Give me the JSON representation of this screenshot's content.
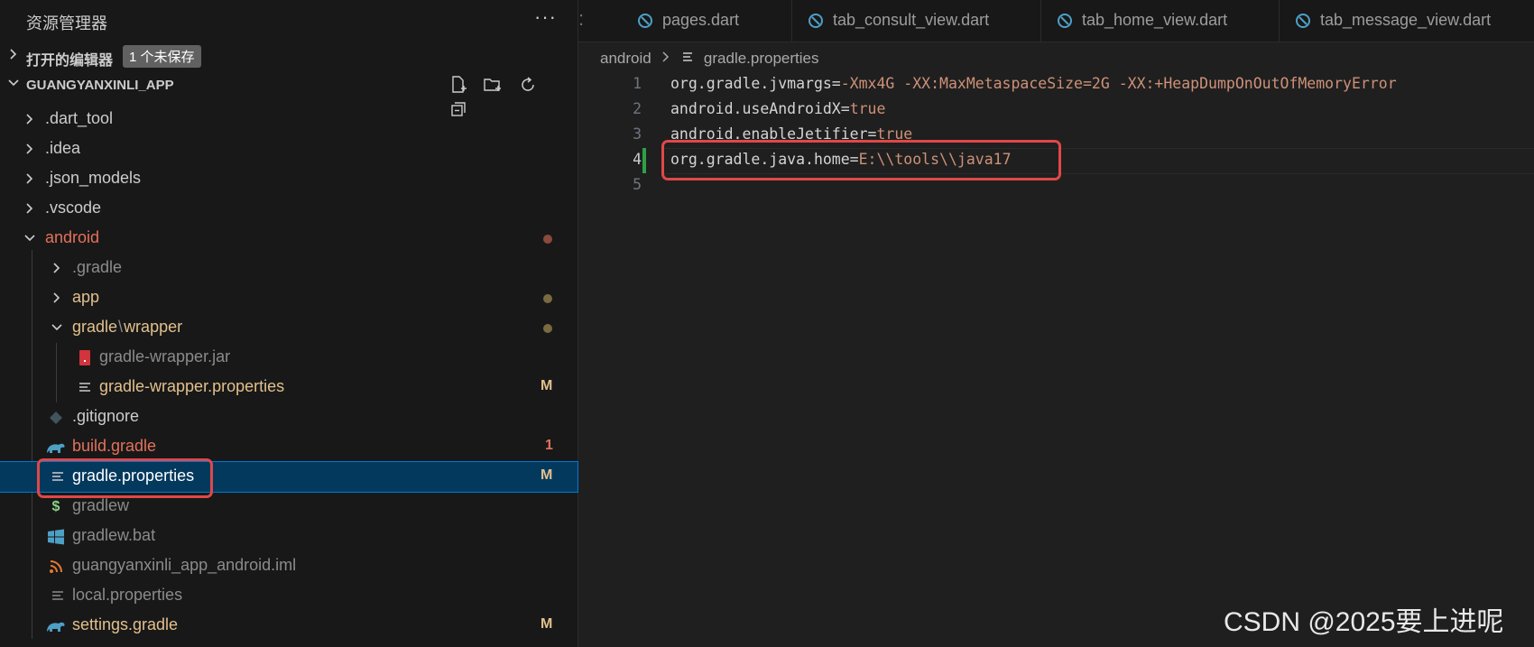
{
  "explorer": {
    "title": "资源管理器",
    "more": "···",
    "open_editors": {
      "label": "打开的编辑器",
      "badge": "1 个未保存"
    },
    "project": {
      "label": "GUANGYANXINLI_APP"
    },
    "tree": [
      {
        "name": ".dart_tool",
        "type": "folder",
        "icon": "chevron-right",
        "color": "#cccccc"
      },
      {
        "name": ".idea",
        "type": "folder",
        "icon": "chevron-right",
        "color": "#cccccc"
      },
      {
        "name": ".json_models",
        "type": "folder",
        "icon": "chevron-right",
        "color": "#cccccc"
      },
      {
        "name": ".vscode",
        "type": "folder",
        "icon": "chevron-right",
        "color": "#cccccc"
      },
      {
        "name": "android",
        "type": "folder-open",
        "icon": "chevron-down",
        "color": "#e2725b",
        "status_dot": "#8b4a3c"
      },
      {
        "name": ".gradle",
        "type": "folder",
        "icon": "chevron-right",
        "color": "#8b8b8b"
      },
      {
        "name": "app",
        "type": "folder",
        "icon": "chevron-right",
        "color": "#e2c08d",
        "status_dot": "#7a6a40"
      },
      {
        "name_a": "gradle",
        "sep": "\\",
        "name_b": "wrapper",
        "type": "folder-open",
        "icon": "chevron-down",
        "color": "#e2c08d",
        "status_dot": "#7a6a40"
      },
      {
        "name": "gradle-wrapper.jar",
        "type": "file",
        "icon": "jar-icon",
        "color": "#8b8b8b"
      },
      {
        "name": "gradle-wrapper.properties",
        "type": "file",
        "icon": "properties-icon",
        "color": "#e2c08d",
        "status": "M"
      },
      {
        "name": ".gitignore",
        "type": "file",
        "icon": "git-icon",
        "color": "#cccccc"
      },
      {
        "name": "build.gradle",
        "type": "file",
        "icon": "gradle-icon",
        "color": "#e2725b",
        "status": "1"
      },
      {
        "name": "gradle.properties",
        "type": "file",
        "icon": "properties-icon",
        "color": "#ffffff",
        "status": "M"
      },
      {
        "name": "gradlew",
        "type": "file",
        "icon": "shell-icon",
        "color": "#8b8b8b"
      },
      {
        "name": "gradlew.bat",
        "type": "file",
        "icon": "windows-icon",
        "color": "#8b8b8b"
      },
      {
        "name": "guangyanxinli_app_android.iml",
        "type": "file",
        "icon": "rss-icon",
        "color": "#8b8b8b"
      },
      {
        "name": "local.properties",
        "type": "file",
        "icon": "properties-icon",
        "color": "#8b8b8b"
      },
      {
        "name": "settings.gradle",
        "type": "file",
        "icon": "gradle-icon",
        "color": "#e2c08d",
        "status": "M"
      }
    ]
  },
  "tabs": [
    {
      "label": "pages.dart"
    },
    {
      "label": "tab_consult_view.dart"
    },
    {
      "label": "tab_home_view.dart"
    },
    {
      "label": "tab_message_view.dart"
    }
  ],
  "breadcrumb": {
    "folder": "android",
    "file": "gradle.properties"
  },
  "code": [
    {
      "n": "1",
      "key": "org.gradle.jvmargs=",
      "val": "-Xmx4G -XX:MaxMetaspaceSize=2G -XX:+HeapDumpOnOutOfMemoryError"
    },
    {
      "n": "2",
      "key": "android.useAndroidX=",
      "val": "true"
    },
    {
      "n": "3",
      "key": "android.enableJetifier=",
      "val": "true"
    },
    {
      "n": "4",
      "key": "org.gradle.java.home=",
      "val": "E:\\\\tools\\\\java17"
    },
    {
      "n": "5",
      "key": "",
      "val": ""
    }
  ],
  "watermark": "CSDN @2025要上进呢",
  "colors": {
    "highlight": "#e04848",
    "accent": "#0078d4"
  }
}
